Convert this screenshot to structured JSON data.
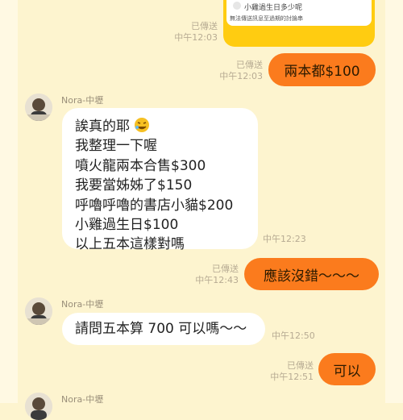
{
  "quote": {
    "text": "小雞過生日多少呢",
    "note": "無法傳送訊息至過期的討論串"
  },
  "meta": {
    "sent": "已傳送"
  },
  "messages": [
    {
      "id": "m1",
      "side": "right",
      "text": "兩本都$100",
      "status": "已傳送",
      "time": "中午12:03"
    },
    {
      "id": "m2",
      "side": "left",
      "sender": "Nora-中壢",
      "lines": [
        "誒真的耶",
        "我整理一下喔",
        "噴火龍兩本合售$300",
        "我要當姊姊了$150",
        "呼嚕呼嚕的書店小貓$200",
        "小雞過生日$100",
        "以上五本這樣對嗎"
      ],
      "time": "中午12:23"
    },
    {
      "id": "m3",
      "side": "right",
      "text": "應該沒錯～～～",
      "status": "已傳送",
      "time": "中午12:43"
    },
    {
      "id": "m4",
      "side": "left",
      "sender": "Nora-中壢",
      "lines": [
        "請問五本算 700 可以嗎～～"
      ],
      "time": "中午12:50"
    },
    {
      "id": "m5",
      "side": "right",
      "text": "可以",
      "status": "已傳送",
      "time": "中午12:51"
    },
    {
      "id": "m6",
      "side": "left",
      "sender": "Nora-中壢"
    }
  ],
  "header_meta": {
    "status": "已傳送",
    "time": "中午12:03"
  },
  "colors": {
    "background": "#fdf4cf",
    "outgoing": "#fb7b1d",
    "incoming": "#ffffff",
    "quote_card": "#ffcc11"
  },
  "icons": {
    "emoji": "rofl-emoji-icon"
  }
}
